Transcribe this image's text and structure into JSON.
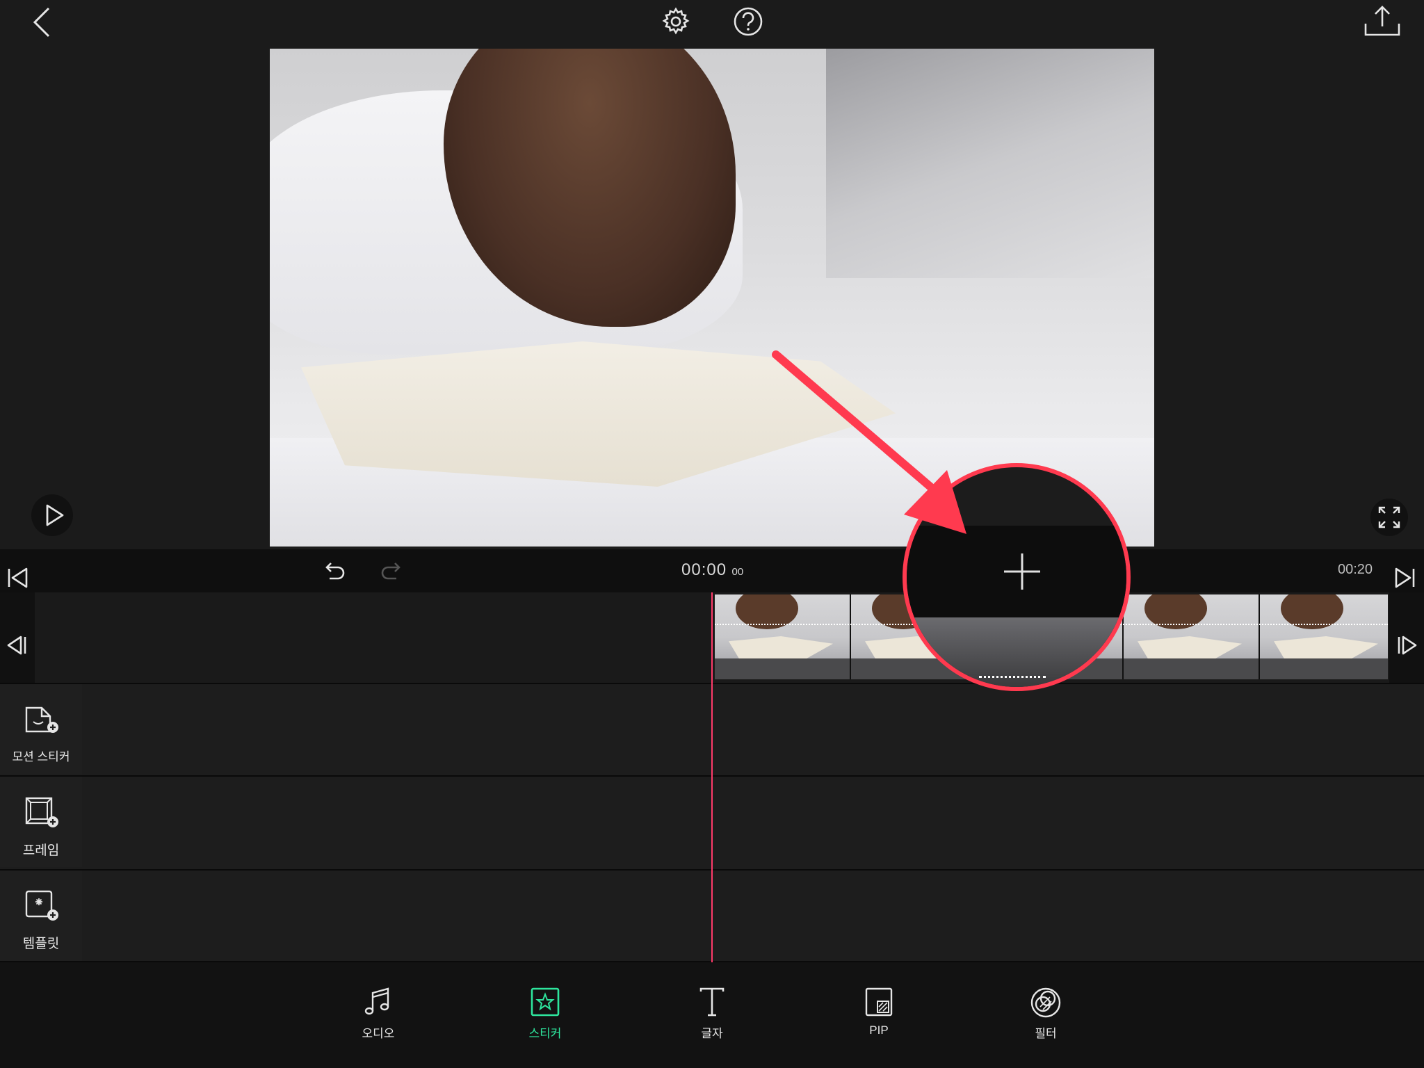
{
  "toolbar": {
    "back_icon": "chevron-left-icon",
    "settings_icon": "gear-icon",
    "help_icon": "question-circle-icon",
    "export_icon": "share-upload-icon"
  },
  "preview": {
    "play_icon": "play-icon",
    "fullscreen_icon": "fullscreen-icon"
  },
  "timeline": {
    "current_time": "00:00",
    "current_frames": "00",
    "end_time": "00:20",
    "add_clip_icon": "plus-icon"
  },
  "tracks": [
    {
      "label": "모션 스티커",
      "icon": "motion-sticker-add-icon"
    },
    {
      "label": "프레임",
      "icon": "frame-add-icon"
    },
    {
      "label": "템플릿",
      "icon": "template-add-icon"
    }
  ],
  "tools": [
    {
      "label": "오디오",
      "icon": "music-note-icon"
    },
    {
      "label": "스티커",
      "icon": "sticker-icon"
    },
    {
      "label": "글자",
      "icon": "text-icon"
    },
    {
      "label": "PIP",
      "icon": "pip-icon"
    },
    {
      "label": "필터",
      "icon": "filter-icon"
    }
  ],
  "colors": {
    "accent_green": "#2ee59d",
    "playhead": "#ff3b6a",
    "annotation_red": "#ff3a4f",
    "background": "#1b1b1b"
  }
}
